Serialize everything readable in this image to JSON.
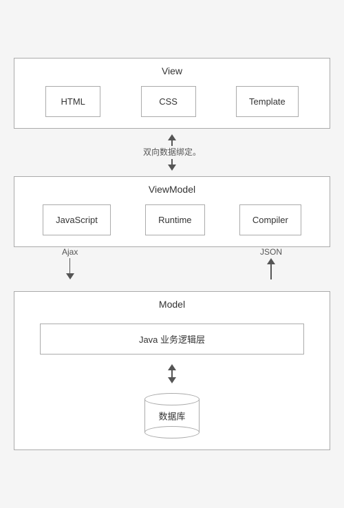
{
  "view": {
    "title": "View",
    "boxes": [
      "HTML",
      "CSS",
      "Template"
    ]
  },
  "connector_middle": {
    "label": "双向数据绑定。"
  },
  "viewmodel": {
    "title": "ViewModel",
    "boxes": [
      "JavaScript",
      "Runtime",
      "Compiler"
    ]
  },
  "connector_bottom": {
    "left_label": "Ajax",
    "right_label": "JSON"
  },
  "model": {
    "title": "Model",
    "java_box": "Java 业务逻辑层",
    "db_label": "数据库"
  }
}
